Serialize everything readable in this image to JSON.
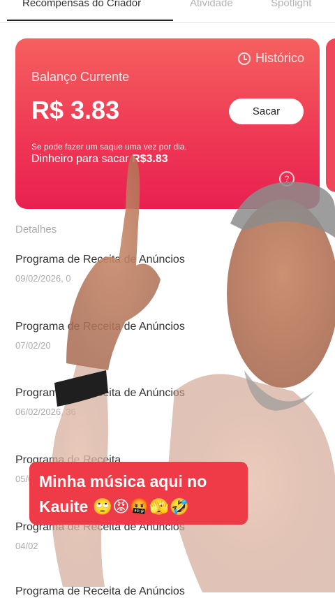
{
  "tabs": [
    {
      "label": "Recompensas do Criador",
      "active": true
    },
    {
      "label": "Atividade",
      "active": false
    },
    {
      "label": "Spotlight",
      "active": false
    }
  ],
  "card": {
    "history_label": "Histórico",
    "balance_label": "Balanço Currente",
    "balance_value": "R$ 3.83",
    "withdraw_button": "Sacar",
    "note_line1": "Se pode fazer um saque uma vez por dia.",
    "note_line2_prefix": "Dinheiro para sacar",
    "note_line2_value": "R$3.83",
    "help_icon": "?"
  },
  "details_label": "Detalhes",
  "items": [
    {
      "title": "Programa de Receita de Anúncios",
      "date": "09/02/2026, 0"
    },
    {
      "title": "Programa de Receita de Anúncios",
      "date": "07/02/20"
    },
    {
      "title": "Programa de Receita de Anúncios",
      "date": "06/02/2026, 36"
    },
    {
      "title": "Programa de Receita",
      "date": "05/0"
    },
    {
      "title": "Programa de Receita de Anúncios",
      "date": "04/02"
    },
    {
      "title": "Programa de Receita de Anúncios",
      "date": ""
    }
  ],
  "caption": {
    "line1": "Minha música aqui no",
    "line2": "Kauite 🙄😡🤬🫣🤣"
  },
  "colors": {
    "card_top": "#f5605e",
    "card_bottom": "#e92050",
    "caption_bg": "#ef3a48"
  }
}
